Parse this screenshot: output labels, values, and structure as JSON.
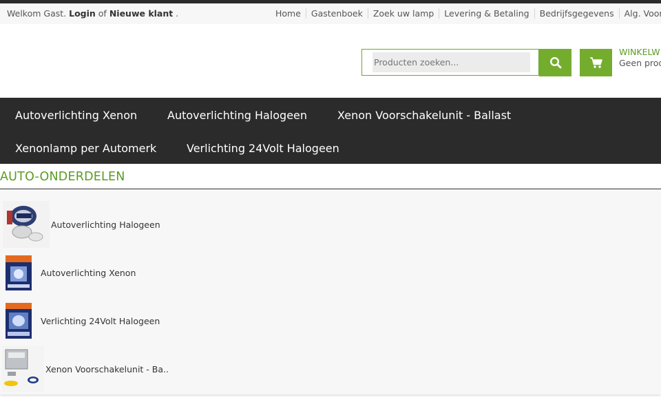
{
  "topbar": {
    "welcome_prefix": "Welkom Gast.",
    "login": "Login",
    "of": "of",
    "new_customer": "Nieuwe klant",
    "dot": ".",
    "links": [
      "Home",
      "Gastenboek",
      "Zoek uw lamp",
      "Levering & Betaling",
      "Bedrijfsgegevens",
      "Alg. Voorwa"
    ]
  },
  "search": {
    "placeholder": "Producten zoeken...",
    "icon": "search-icon"
  },
  "cart": {
    "icon": "cart-icon",
    "title": "WINKELW",
    "subtitle": "Geen prod"
  },
  "nav": {
    "items": [
      "Autoverlichting Xenon",
      "Autoverlichting Halogeen",
      "Xenon Voorschakelunit - Ballast",
      "Xenonlamp per Automerk",
      "Verlichting 24Volt Halogeen"
    ]
  },
  "section": {
    "title": "AUTO-ONDERDELEN",
    "categories": [
      "Autoverlichting Halogeen",
      "Autoverlichting Xenon",
      "Verlichting 24Volt Halogeen",
      "Xenon Voorschakelunit - Ba.."
    ]
  },
  "colors": {
    "accent": "#74ad2d",
    "accent_text": "#5a9c22",
    "nav_bg": "#2b2b2b"
  }
}
